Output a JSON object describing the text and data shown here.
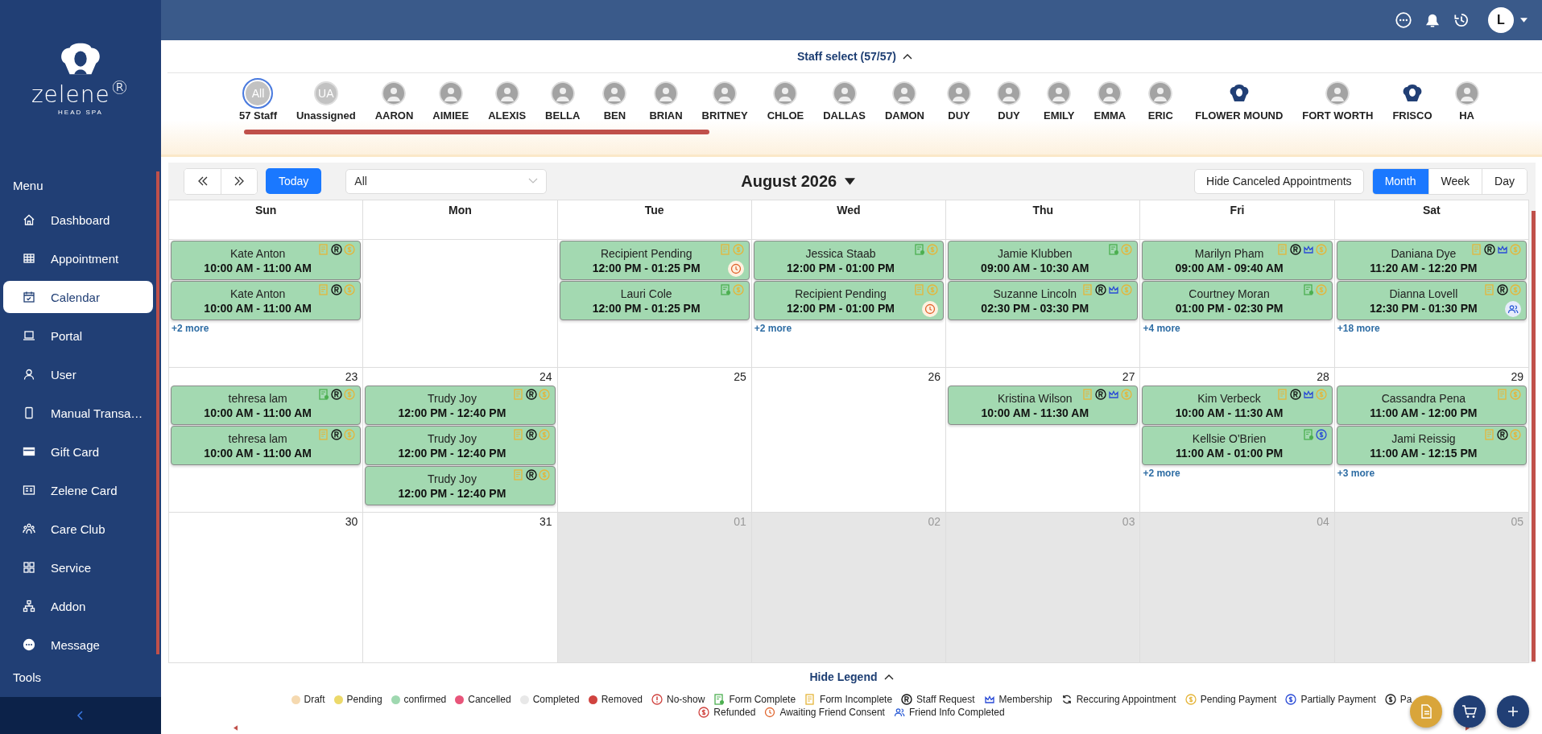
{
  "sidebar": {
    "brand": "zelene$^{®}$",
    "brand_sub": "HEAD SPA",
    "section": "Menu",
    "items": [
      {
        "label": "Dashboard",
        "selected": false
      },
      {
        "label": "Appointment",
        "selected": false
      },
      {
        "label": "Calendar",
        "selected": true
      },
      {
        "label": "Portal",
        "selected": false
      },
      {
        "label": "User",
        "selected": false
      },
      {
        "label": "Manual Transa…",
        "selected": false
      },
      {
        "label": "Gift Card",
        "selected": false
      },
      {
        "label": "Zelene Card",
        "selected": false
      },
      {
        "label": "Care Club",
        "selected": false
      },
      {
        "label": "Service",
        "selected": false
      },
      {
        "label": "Addon",
        "selected": false
      },
      {
        "label": "Message",
        "selected": false
      }
    ],
    "footer_section": "Tools"
  },
  "topbar": {
    "avatar": "L"
  },
  "staff_select": {
    "title": "Staff select (57/57)",
    "staff": [
      {
        "kind": "initials",
        "initials": "All",
        "label": "57 Staff",
        "selected": true
      },
      {
        "kind": "initials",
        "initials": "UA",
        "label": "Unassigned",
        "selected": false
      },
      {
        "kind": "person",
        "label": "AARON",
        "selected": false
      },
      {
        "kind": "person",
        "label": "AIMIEE",
        "selected": false
      },
      {
        "kind": "person",
        "label": "ALEXIS",
        "selected": false
      },
      {
        "kind": "person",
        "label": "BELLA",
        "selected": false
      },
      {
        "kind": "person",
        "label": "BEN",
        "selected": false
      },
      {
        "kind": "person",
        "label": "BRIAN",
        "selected": false
      },
      {
        "kind": "person",
        "label": "BRITNEY",
        "selected": false
      },
      {
        "kind": "person",
        "label": "CHLOE",
        "selected": false
      },
      {
        "kind": "person",
        "label": "DALLAS",
        "selected": false
      },
      {
        "kind": "person",
        "label": "DAMON",
        "selected": false
      },
      {
        "kind": "person",
        "label": "DUY",
        "selected": false
      },
      {
        "kind": "person",
        "label": "DUY",
        "selected": false
      },
      {
        "kind": "person",
        "label": "EMILY",
        "selected": false
      },
      {
        "kind": "person",
        "label": "EMMA",
        "selected": false
      },
      {
        "kind": "person",
        "label": "ERIC",
        "selected": false
      },
      {
        "kind": "logo",
        "label": "FLOWER MOUND",
        "selected": false
      },
      {
        "kind": "person",
        "label": "FORT WORTH",
        "selected": false
      },
      {
        "kind": "logo",
        "label": "FRISCO",
        "selected": false
      },
      {
        "kind": "person",
        "label": "HA",
        "selected": false
      }
    ]
  },
  "toolbar": {
    "today": "Today",
    "filter": "All",
    "month_title": "August 2026",
    "hide_canceled": "Hide Canceled Appointments",
    "views": [
      {
        "label": "Month",
        "selected": true
      },
      {
        "label": "Week",
        "selected": false
      },
      {
        "label": "Day",
        "selected": false
      }
    ]
  },
  "calendar": {
    "weekdays": [
      "Sun",
      "Mon",
      "Tue",
      "Wed",
      "Thu",
      "Fri",
      "Sat"
    ],
    "weeks": [
      {
        "days": [
          {
            "outside": false,
            "events": [
              {
                "name": "Kate Anton",
                "time": "10:00 AM - 11:00 AM",
                "form_complete": false,
                "staff_request": true,
                "membership": false,
                "partial_payment": false,
                "awaiting_consent": false,
                "friend_info": false
              },
              {
                "name": "Kate Anton",
                "time": "10:00 AM - 11:00 AM",
                "form_complete": false,
                "staff_request": true,
                "membership": false,
                "partial_payment": false,
                "awaiting_consent": false,
                "friend_info": false
              }
            ],
            "more": "+2 more"
          },
          {
            "outside": false
          },
          {
            "outside": false,
            "events": [
              {
                "name": "Recipient Pending",
                "time": "12:00 PM - 01:25 PM",
                "form_complete": false,
                "staff_request": false,
                "membership": false,
                "partial_payment": false,
                "awaiting_consent": true,
                "friend_info": false
              },
              {
                "name": "Lauri Cole",
                "time": "12:00 PM - 01:25 PM",
                "form_complete": true,
                "staff_request": false,
                "membership": false,
                "partial_payment": false,
                "awaiting_consent": false,
                "friend_info": false
              }
            ]
          },
          {
            "outside": false,
            "events": [
              {
                "name": "Jessica Staab",
                "time": "12:00 PM - 01:00 PM",
                "form_complete": true,
                "staff_request": false,
                "membership": false,
                "partial_payment": false,
                "awaiting_consent": false,
                "friend_info": false
              },
              {
                "name": "Recipient Pending",
                "time": "12:00 PM - 01:00 PM",
                "form_complete": false,
                "staff_request": false,
                "membership": false,
                "partial_payment": false,
                "awaiting_consent": true,
                "friend_info": false
              }
            ],
            "more": "+2 more"
          },
          {
            "outside": false,
            "events": [
              {
                "name": "Jamie Klubben",
                "time": "09:00 AM - 10:30 AM",
                "form_complete": true,
                "staff_request": false,
                "membership": false,
                "partial_payment": false,
                "awaiting_consent": false,
                "friend_info": false
              },
              {
                "name": "Suzanne Lincoln",
                "time": "02:30 PM - 03:30 PM",
                "form_complete": false,
                "staff_request": true,
                "membership": true,
                "partial_payment": false,
                "awaiting_consent": false,
                "friend_info": false
              }
            ]
          },
          {
            "outside": false,
            "events": [
              {
                "name": "Marilyn Pham",
                "time": "09:00 AM - 09:40 AM",
                "form_complete": false,
                "staff_request": true,
                "membership": true,
                "partial_payment": false,
                "awaiting_consent": false,
                "friend_info": false
              },
              {
                "name": "Courtney Moran",
                "time": "01:00 PM - 02:30 PM",
                "form_complete": true,
                "staff_request": false,
                "membership": false,
                "partial_payment": false,
                "awaiting_consent": false,
                "friend_info": false
              }
            ],
            "more": "+4 more"
          },
          {
            "outside": false,
            "events": [
              {
                "name": "Daniana Dye",
                "time": "11:20 AM - 12:20 PM",
                "form_complete": false,
                "staff_request": true,
                "membership": true,
                "partial_payment": false,
                "awaiting_consent": false,
                "friend_info": false
              },
              {
                "name": "Dianna Lovell",
                "time": "12:30 PM - 01:30 PM",
                "form_complete": false,
                "staff_request": true,
                "membership": false,
                "partial_payment": false,
                "awaiting_consent": false,
                "friend_info": true
              }
            ],
            "more": "+18 more"
          }
        ]
      },
      {
        "days": [
          {
            "date": "23",
            "outside": false,
            "events": [
              {
                "name": "tehresa lam",
                "time": "10:00 AM - 11:00 AM",
                "form_complete": true,
                "staff_request": true,
                "membership": false,
                "partial_payment": false,
                "awaiting_consent": false,
                "friend_info": false
              },
              {
                "name": "tehresa lam",
                "time": "10:00 AM - 11:00 AM",
                "form_complete": false,
                "staff_request": true,
                "membership": false,
                "partial_payment": false,
                "awaiting_consent": false,
                "friend_info": false
              }
            ]
          },
          {
            "date": "24",
            "outside": false,
            "events": [
              {
                "name": "Trudy Joy",
                "time": "12:00 PM - 12:40 PM",
                "form_complete": false,
                "staff_request": true,
                "membership": false,
                "partial_payment": false,
                "awaiting_consent": false,
                "friend_info": false
              },
              {
                "name": "Trudy Joy",
                "time": "12:00 PM - 12:40 PM",
                "form_complete": false,
                "staff_request": true,
                "membership": false,
                "partial_payment": false,
                "awaiting_consent": false,
                "friend_info": false
              },
              {
                "name": "Trudy Joy",
                "time": "12:00 PM - 12:40 PM",
                "form_complete": false,
                "staff_request": true,
                "membership": false,
                "partial_payment": false,
                "awaiting_consent": false,
                "friend_info": false
              }
            ]
          },
          {
            "date": "25",
            "outside": false
          },
          {
            "date": "26",
            "outside": false
          },
          {
            "date": "27",
            "outside": false,
            "events": [
              {
                "name": "Kristina Wilson",
                "time": "10:00 AM - 11:30 AM",
                "form_complete": false,
                "staff_request": true,
                "membership": true,
                "partial_payment": false,
                "awaiting_consent": false,
                "friend_info": false
              }
            ]
          },
          {
            "date": "28",
            "outside": false,
            "events": [
              {
                "name": "Kim Verbeck",
                "time": "10:00 AM - 11:30 AM",
                "form_complete": false,
                "staff_request": true,
                "membership": true,
                "partial_payment": false,
                "awaiting_consent": false,
                "friend_info": false
              },
              {
                "name": "Kellsie O'Brien",
                "time": "11:00 AM - 01:00 PM",
                "form_complete": true,
                "staff_request": false,
                "membership": false,
                "partial_payment": true,
                "awaiting_consent": false,
                "friend_info": false
              }
            ],
            "more": "+2 more"
          },
          {
            "date": "29",
            "outside": false,
            "events": [
              {
                "name": "Cassandra Pena",
                "time": "11:00 AM - 12:00 PM",
                "form_complete": false,
                "staff_request": false,
                "membership": false,
                "partial_payment": false,
                "awaiting_consent": false,
                "friend_info": false
              },
              {
                "name": "Jami Reissig",
                "time": "11:00 AM - 12:15 PM",
                "form_complete": false,
                "staff_request": true,
                "membership": false,
                "partial_payment": false,
                "awaiting_consent": false,
                "friend_info": false
              }
            ],
            "more": "+3 more"
          }
        ]
      },
      {
        "days": [
          {
            "date": "30",
            "outside": false
          },
          {
            "date": "31",
            "outside": false
          },
          {
            "date": "01",
            "outside": true
          },
          {
            "date": "02",
            "outside": true
          },
          {
            "date": "03",
            "outside": true
          },
          {
            "date": "04",
            "outside": true
          },
          {
            "date": "05",
            "outside": true
          }
        ]
      }
    ]
  },
  "legend": {
    "toggle": "Hide Legend",
    "items": [
      {
        "kind": "dot",
        "color": "#f5d9b0",
        "label": "Draft"
      },
      {
        "kind": "dot",
        "color": "#ecd96a",
        "label": "Pending"
      },
      {
        "kind": "dot",
        "color": "#9fd8b0",
        "label": "confirmed"
      },
      {
        "kind": "dot",
        "color": "#e8557a",
        "label": "Cancelled"
      },
      {
        "kind": "dot",
        "color": "#e8e8e8",
        "label": "Completed"
      },
      {
        "kind": "dot",
        "color": "#d0433f",
        "label": "Removed"
      },
      {
        "kind": "no_show",
        "label": "No-show"
      },
      {
        "kind": "form_complete",
        "label": "Form Complete"
      },
      {
        "kind": "form_incomplete",
        "label": "Form Incomplete"
      },
      {
        "kind": "staff_request",
        "label": "Staff Request"
      },
      {
        "kind": "membership",
        "label": "Membership"
      },
      {
        "kind": "recurring",
        "label": "Reccuring Appointment"
      },
      {
        "kind": "pending_payment",
        "label": "Pending Payment"
      },
      {
        "kind": "partial_payment",
        "label": "Partially Payment"
      },
      {
        "kind": "paid",
        "label": "Pa"
      },
      {
        "kind": "refunded",
        "label": "Refunded"
      },
      {
        "kind": "awaiting_consent",
        "label": "Awaiting Friend Consent"
      },
      {
        "kind": "friend_info",
        "label": "Friend Info Completed"
      }
    ]
  }
}
